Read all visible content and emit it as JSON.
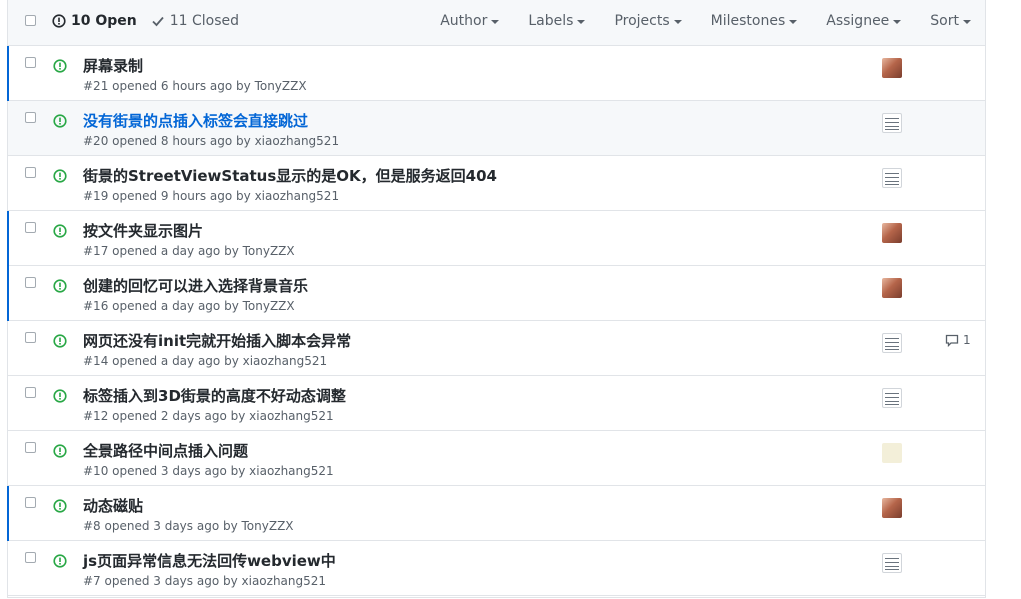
{
  "header": {
    "open_label": "10 Open",
    "closed_label": "11 Closed",
    "filters": [
      "Author",
      "Labels",
      "Projects",
      "Milestones",
      "Assignee",
      "Sort"
    ]
  },
  "issues": [
    {
      "title": "屏幕录制",
      "meta": "#21 opened 6 hours ago by TonyZZX",
      "avatar": "photo-avatar",
      "unread": true,
      "hover": false,
      "comments": ""
    },
    {
      "title": "没有街景的点插入标签会直接跳过",
      "meta": "#20 opened 8 hours ago by xiaozhang521",
      "avatar": "doc-avatar",
      "unread": false,
      "hover": true,
      "comments": ""
    },
    {
      "title": "街景的StreetViewStatus显示的是OK，但是服务返回404",
      "meta": "#19 opened 9 hours ago by xiaozhang521",
      "avatar": "doc-avatar",
      "unread": false,
      "hover": false,
      "comments": ""
    },
    {
      "title": "按文件夹显示图片",
      "meta": "#17 opened a day ago by TonyZZX",
      "avatar": "photo-avatar",
      "unread": true,
      "hover": false,
      "comments": ""
    },
    {
      "title": "创建的回忆可以进入选择背景音乐",
      "meta": "#16 opened a day ago by TonyZZX",
      "avatar": "photo-avatar",
      "unread": true,
      "hover": false,
      "comments": ""
    },
    {
      "title": "网页还没有init完就开始插入脚本会异常",
      "meta": "#14 opened a day ago by xiaozhang521",
      "avatar": "doc-avatar",
      "unread": false,
      "hover": false,
      "comments": "1"
    },
    {
      "title": "标签插入到3D街景的高度不好动态调整",
      "meta": "#12 opened 2 days ago by xiaozhang521",
      "avatar": "doc-avatar",
      "unread": false,
      "hover": false,
      "comments": ""
    },
    {
      "title": "全景路径中间点插入问题",
      "meta": "#10 opened 3 days ago by xiaozhang521",
      "avatar": "plant-avatar",
      "unread": false,
      "hover": false,
      "comments": ""
    },
    {
      "title": "动态磁贴",
      "meta": "#8 opened 3 days ago by TonyZZX",
      "avatar": "photo-avatar",
      "unread": true,
      "hover": false,
      "comments": ""
    },
    {
      "title": "js页面异常信息无法回传webview中",
      "meta": "#7 opened 3 days ago by xiaozhang521",
      "avatar": "doc-avatar",
      "unread": false,
      "hover": false,
      "comments": ""
    }
  ],
  "colors": {
    "open_icon": "#28a745",
    "unread_bar": "#0366d6",
    "link_hover": "#0366d6"
  }
}
